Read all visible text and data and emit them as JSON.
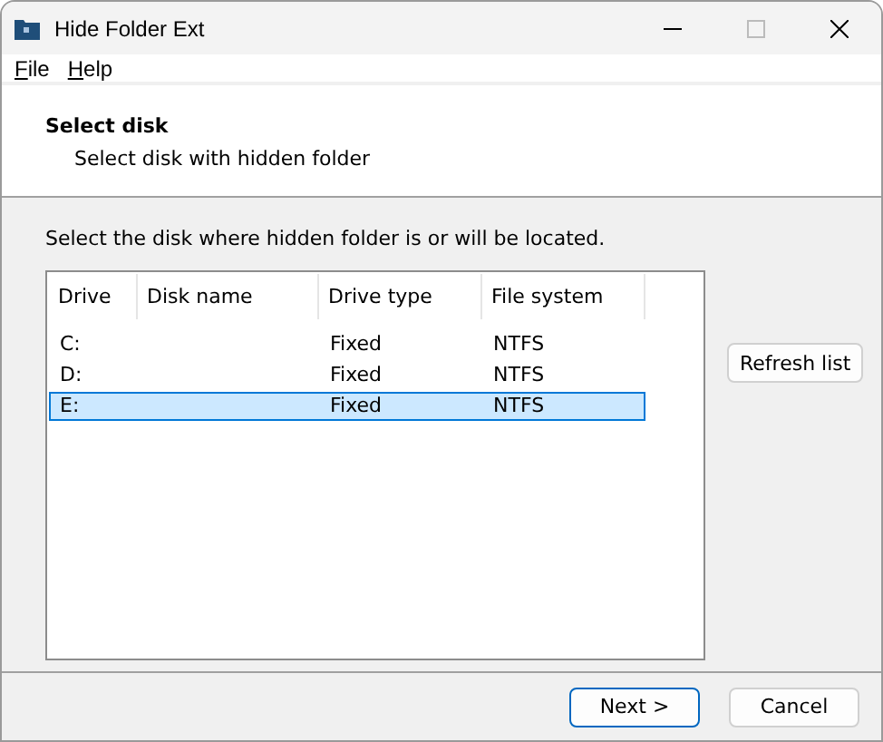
{
  "window": {
    "title": "Hide Folder Ext"
  },
  "menu": [
    {
      "label": "File"
    },
    {
      "label": "Help"
    }
  ],
  "header": {
    "title": "Select disk",
    "subtitle": "Select disk with hidden folder"
  },
  "instruction": "Select the disk where hidden folder is or will be located.",
  "table": {
    "columns": [
      "Drive",
      "Disk name",
      "Drive type",
      "File system"
    ],
    "rows": [
      {
        "cells": [
          "C:",
          "",
          "Fixed",
          "NTFS"
        ],
        "selected": false
      },
      {
        "cells": [
          "D:",
          "",
          "Fixed",
          "NTFS"
        ],
        "selected": false
      },
      {
        "cells": [
          "E:",
          "",
          "Fixed",
          "NTFS"
        ],
        "selected": true
      }
    ]
  },
  "side_button": "Refresh list",
  "buttons": [
    {
      "label": "Next >",
      "default": true
    },
    {
      "label": "Cancel",
      "default": false
    }
  ]
}
